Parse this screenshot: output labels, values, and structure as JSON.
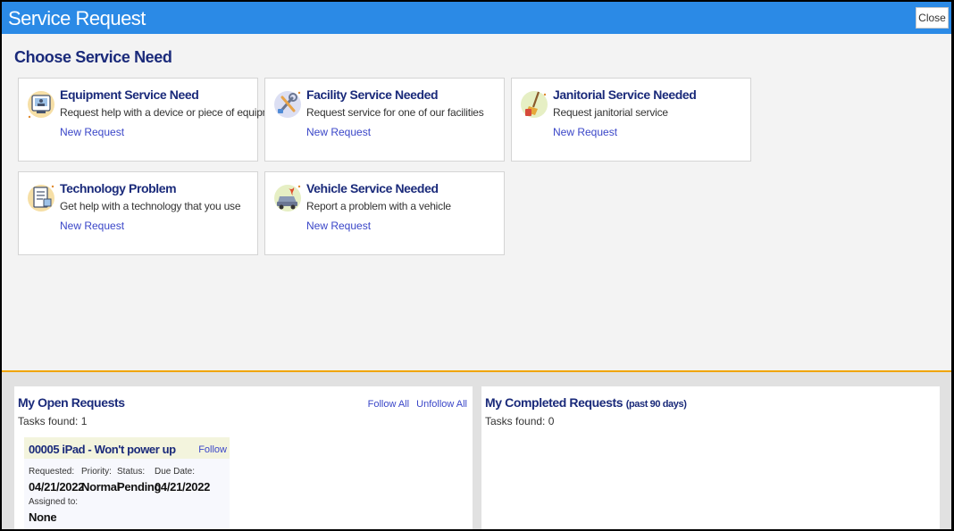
{
  "window": {
    "title": "Service Request",
    "close_label": "Close"
  },
  "choose": {
    "heading": "Choose Service Need",
    "cards": [
      {
        "title": "Equipment Service Need",
        "desc": "Request help with a device or piece of equipment",
        "link": "New Request",
        "icon": "equipment-icon"
      },
      {
        "title": "Facility Service Needed",
        "desc": "Request service for one of our facilities",
        "link": "New Request",
        "icon": "facility-tools-icon"
      },
      {
        "title": "Janitorial Service Needed",
        "desc": "Request janitorial service",
        "link": "New Request",
        "icon": "janitorial-broom-icon"
      },
      {
        "title": "Technology Problem",
        "desc": "Get help with a technology that you use",
        "link": "New Request",
        "icon": "technology-icon"
      },
      {
        "title": "Vehicle Service Needed",
        "desc": "Report a problem with a vehicle",
        "link": "New Request",
        "icon": "vehicle-icon"
      }
    ]
  },
  "open_requests": {
    "title": "My Open Requests",
    "tasks_found": "Tasks found: 1",
    "follow_all": "Follow All",
    "unfollow_all": "Unfollow All",
    "items": [
      {
        "title": "00005 iPad - Won't power up",
        "follow": "Follow",
        "requested_label": "Requested:",
        "requested": "04/21/2022",
        "priority_label": "Priority:",
        "priority": "Normal",
        "status_label": "Status:",
        "status": "Pending",
        "due_label": "Due Date:",
        "due": "04/21/2022",
        "assigned_label": "Assigned to:",
        "assigned": "None"
      }
    ]
  },
  "completed_requests": {
    "title": "My Completed Requests",
    "subtitle": "(past 90 days)",
    "tasks_found": "Tasks found: 0"
  },
  "colors": {
    "titlebar": "#2b8ae6",
    "heading": "#1a2a7a",
    "link": "#3a46c8",
    "divider": "#f0a500"
  }
}
